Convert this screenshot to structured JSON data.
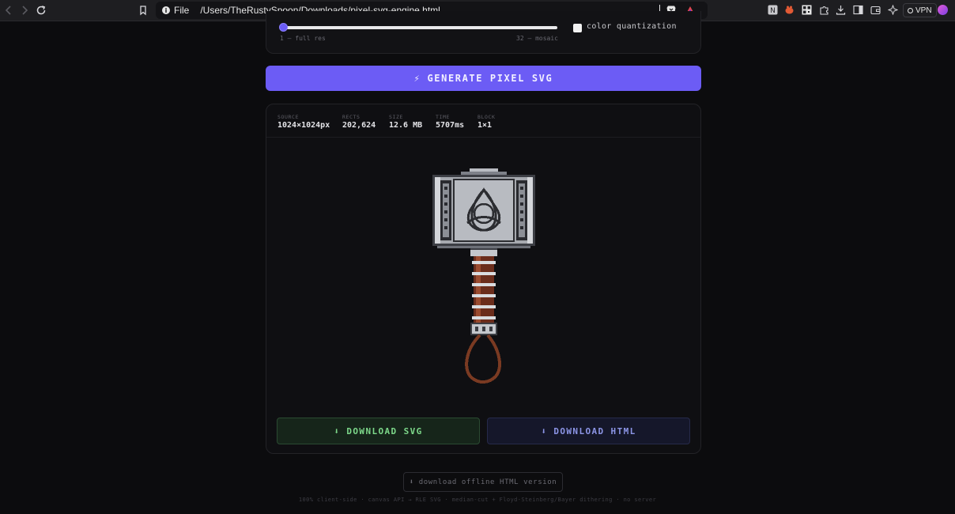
{
  "browser": {
    "protocol_label": "File",
    "url_path": "/Users/TheRustySpoon/Downloads/pixel-svg-engine.html",
    "vpn_label": "VPN"
  },
  "settings": {
    "block_size_value": 1,
    "block_min_label": "1 — full res",
    "block_max_label": "32 — mosaic",
    "quantization_label": "color quantization",
    "quantization_checked": false
  },
  "generate": {
    "icon": "⚡",
    "label": "GENERATE PIXEL SVG",
    "color": "#6c5cf5"
  },
  "stats": [
    {
      "label": "SOURCE",
      "value": "1024×1024px"
    },
    {
      "label": "RECTS",
      "value": "202,624"
    },
    {
      "label": "SIZE",
      "value": "12.6 MB"
    },
    {
      "label": "TIME",
      "value": "5707ms"
    },
    {
      "label": "BLOCK",
      "value": "1×1"
    }
  ],
  "preview": {
    "subject": "pixel-art hammer with knot emblem"
  },
  "downloads": {
    "svg": {
      "icon": "⬇",
      "label": "DOWNLOAD SVG",
      "color": "#7dd88a"
    },
    "html": {
      "icon": "⬇",
      "label": "DOWNLOAD HTML",
      "color": "#8c95e6"
    }
  },
  "footer": {
    "offline_icon": "⬇",
    "offline_label": "download offline HTML version",
    "note": "100% client-side · canvas API → RLE SVG · median-cut + Floyd-Steinberg/Bayer dithering · no server"
  }
}
